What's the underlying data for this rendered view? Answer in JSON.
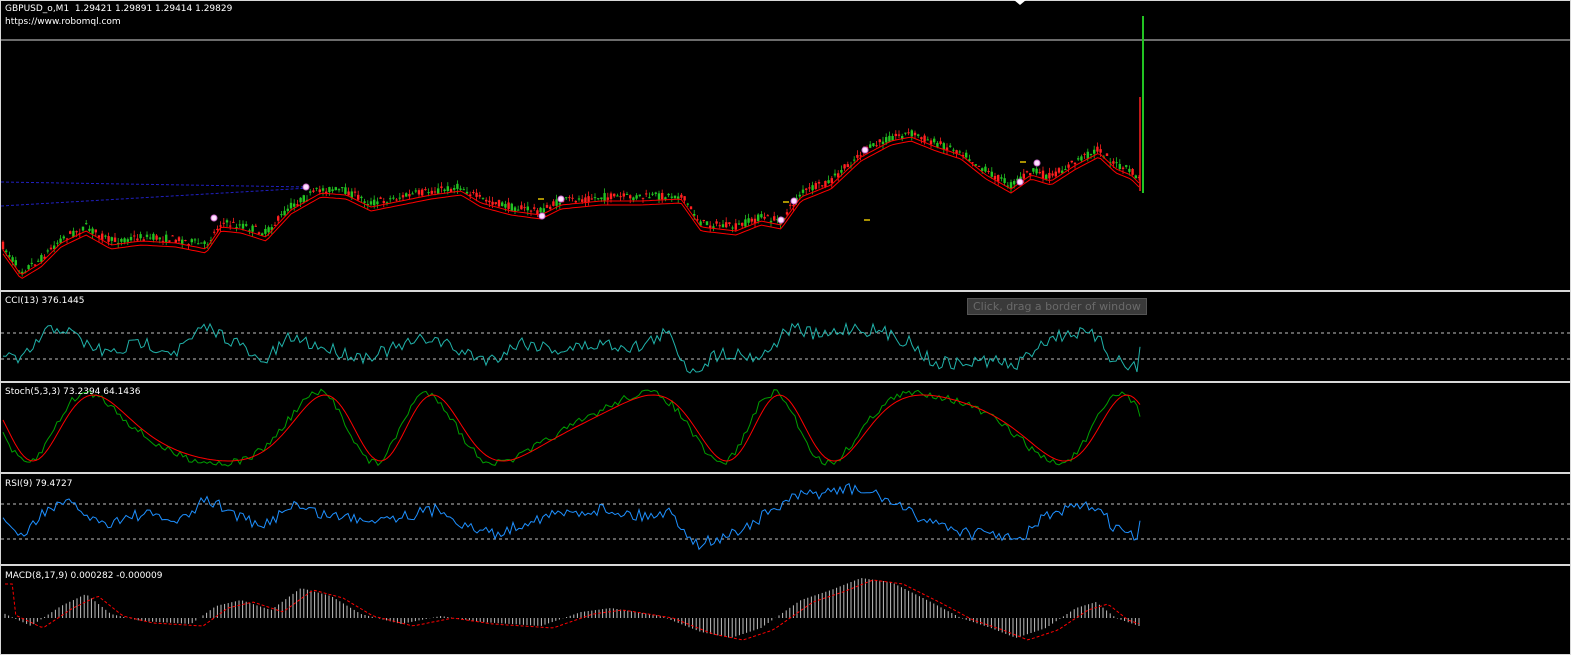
{
  "main": {
    "symbol_line": "GBPUSD_o,M1  1.29421 1.29891 1.29414 1.29829",
    "website": "https://www.robomql.com"
  },
  "cci": {
    "label": "CCI(13) 376.1445"
  },
  "stoch": {
    "label": "Stoch(5,3,3) 73.2394 64.1436"
  },
  "rsi": {
    "label": "RSI(9) 79.4727"
  },
  "macd": {
    "label": "MACD(8,17,9) 0.000282 -0.000009"
  },
  "tooltip": {
    "text": "Click, drag a border of window"
  },
  "colors": {
    "background": "#000000",
    "border": "#d8d8d8",
    "bull_candle": "#22c322",
    "bear_candle": "#ff2020",
    "ma_line": "#ff0000",
    "cci_line": "#20b2aa",
    "stoch_main": "#00a000",
    "stoch_signal": "#ff0000",
    "rsi_line": "#1e90ff",
    "macd_hist": "#c0c0c0",
    "macd_signal": "#ff0000",
    "level_line": "#c0c0c0",
    "trendline": "#2020c0"
  }
}
